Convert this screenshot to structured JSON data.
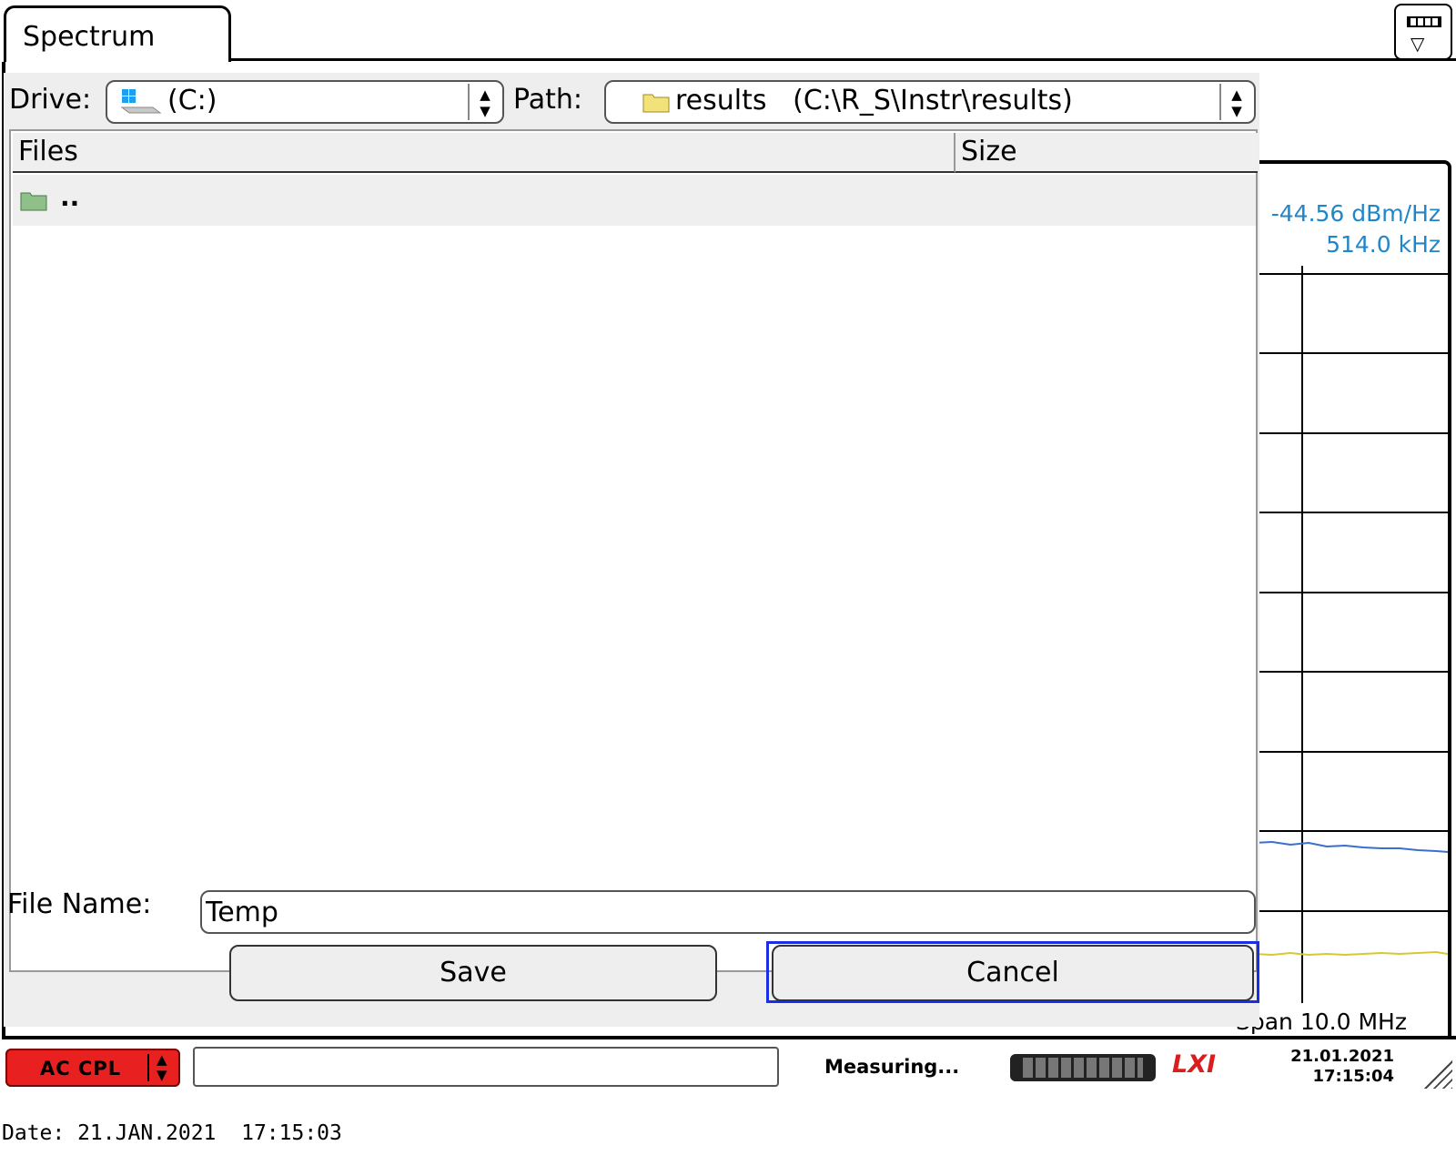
{
  "tab": {
    "label": "Spectrum"
  },
  "diagram": {
    "marker_level": "-44.56 dBm/Hz",
    "marker_freq": "514.0 kHz",
    "span": "Span 10.0 MHz",
    "trace_colors": {
      "blue": "#3a6fd0",
      "yellow": "#d8c830"
    }
  },
  "dialog": {
    "drive_label": "Drive:",
    "drive_value": "(C:)",
    "path_label": "Path:",
    "path_value": "results   (C:\\R_S\\Instr\\results)",
    "columns": {
      "files": "Files",
      "size": "Size"
    },
    "rows": [
      {
        "name": "..",
        "icon": "folder-icon"
      }
    ],
    "filename_label": "File Name:",
    "filename_value": "Temp",
    "save_label": "Save",
    "cancel_label": "Cancel",
    "accent": "#1a2ee6"
  },
  "statusbar": {
    "input_coupling": "AC CPL",
    "status": "Measuring...",
    "logo": "LXI",
    "date": "21.01.2021",
    "time": "17:15:04",
    "input_coupling_color": "#e82020"
  },
  "footer": {
    "date_line": "Date: 21.JAN.2021  17:15:03"
  }
}
